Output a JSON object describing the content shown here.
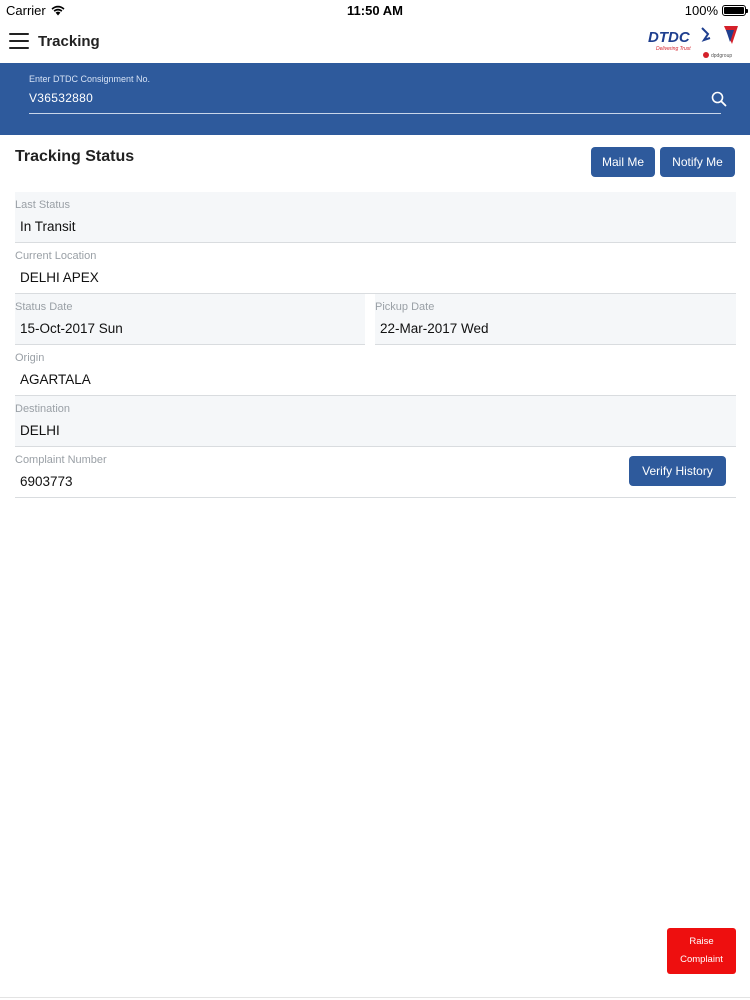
{
  "status_bar": {
    "carrier": "Carrier",
    "time": "11:50 AM",
    "battery": "100%"
  },
  "nav": {
    "title": "Tracking",
    "logo_text": "DTDC",
    "logo_tagline": "Delivering Trust",
    "logo_sub": "dpdgroup"
  },
  "search": {
    "label": "Enter DTDC Consignment No.",
    "value": "V36532880"
  },
  "tracking": {
    "title": "Tracking Status",
    "mail_button": "Mail Me",
    "notify_button": "Notify Me",
    "last_status": {
      "label": "Last Status",
      "value": "In Transit"
    },
    "current_location": {
      "label": "Current Location",
      "value": "DELHI APEX"
    },
    "status_date": {
      "label": "Status Date",
      "value": "15-Oct-2017 Sun"
    },
    "pickup_date": {
      "label": "Pickup Date",
      "value": "22-Mar-2017 Wed"
    },
    "origin": {
      "label": "Origin",
      "value": "AGARTALA"
    },
    "destination": {
      "label": "Destination",
      "value": "DELHI"
    },
    "complaint_number": {
      "label": "Complaint Number",
      "value": "6903773"
    },
    "verify_button": "Verify History"
  },
  "raise_complaint": {
    "line1": "Raise",
    "line2": "Complaint"
  },
  "colors": {
    "brand_blue": "#2e5a9c",
    "raise_red": "#ee0f0f",
    "field_bg": "#f5f7f9"
  }
}
